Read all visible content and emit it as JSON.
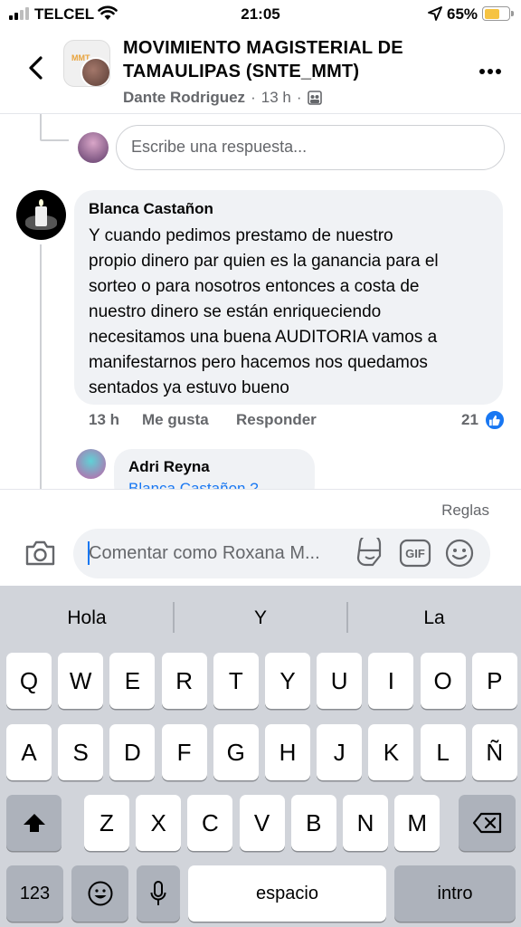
{
  "status_bar": {
    "carrier": "TELCEL",
    "time": "21:05",
    "battery_percent": "65%",
    "battery_level": 0.65,
    "battery_color": "#f6c342"
  },
  "header": {
    "group_name": "MOVIMIENTO MAGISTERIAL DE TAMAULIPAS (SNTE_MMT)",
    "author": "Dante Rodriguez",
    "time": "13 h",
    "separator": "·",
    "logo_text": "MMT",
    "icons": {
      "back": "chevron-left-icon",
      "more": "more-horizontal-icon",
      "privacy": "group-icon"
    }
  },
  "reply_input": {
    "placeholder": "Escribe una respuesta..."
  },
  "comment": {
    "author": "Blanca Castañon",
    "text": "Y cuando pedimos prestamo de nuestro\npropio dinero  par quien es la ganancia para el\nsorteo o para nosotros entonces a costa de\nnuestro dinero se están enriqueciendo\nnecesitamos  una buena  AUDITORIA  vamos a\nmanifestarnos pero  hacemos  nos quedamos\nsentados ya estuvo bueno",
    "time": "13 h",
    "like_label": "Me gusta",
    "reply_label": "Responder",
    "like_count": "21"
  },
  "reply": {
    "author": "Adri Reyna",
    "mention": "Blanca Castañon ?"
  },
  "composer": {
    "rules_label": "Reglas",
    "placeholder": "Comentar como Roxana M...",
    "gif_label": "GIF"
  },
  "keyboard": {
    "suggestions": [
      "Hola",
      "Y",
      "La"
    ],
    "row1": [
      "Q",
      "W",
      "E",
      "R",
      "T",
      "Y",
      "U",
      "I",
      "O",
      "P"
    ],
    "row2": [
      "A",
      "S",
      "D",
      "F",
      "G",
      "H",
      "J",
      "K",
      "L",
      "Ñ"
    ],
    "row3": [
      "Z",
      "X",
      "C",
      "V",
      "B",
      "N",
      "M"
    ],
    "numbers_label": "123",
    "space_label": "espacio",
    "return_label": "intro"
  },
  "colors": {
    "accent": "#1877f2",
    "secondary_text": "#65676b",
    "bubble": "#f0f2f5"
  }
}
